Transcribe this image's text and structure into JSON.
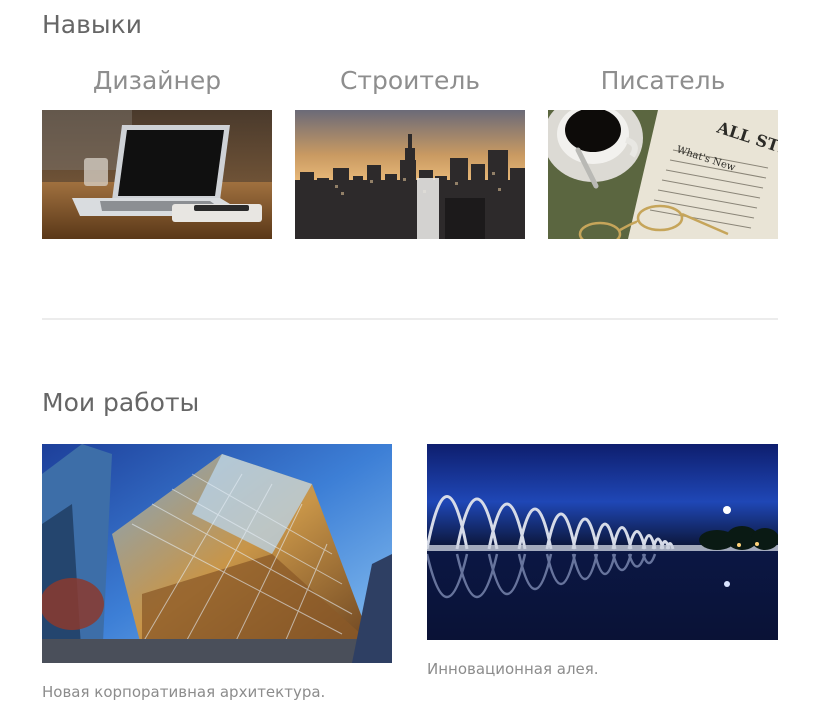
{
  "skills": {
    "heading": "Навыки",
    "items": [
      {
        "label": "Дизайнер"
      },
      {
        "label": "Строитель"
      },
      {
        "label": "Писатель"
      }
    ]
  },
  "works": {
    "heading": "Мои работы",
    "items": [
      {
        "caption": "Новая корпоративная архитектура."
      },
      {
        "caption": "Инновационная алея."
      }
    ]
  },
  "newspaper_text": {
    "masthead": "ALL STREE",
    "headline": "What's New"
  }
}
